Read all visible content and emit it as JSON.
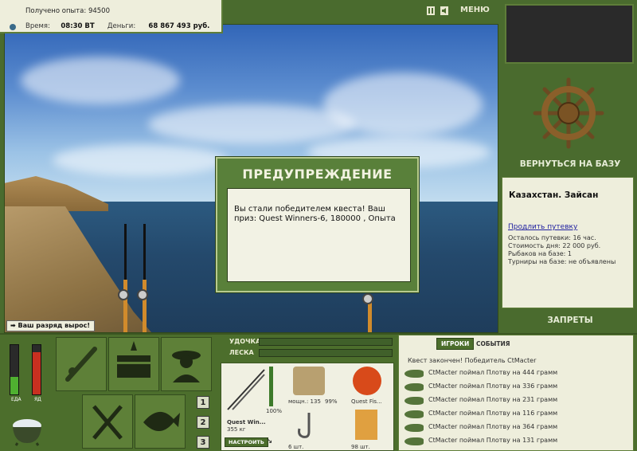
{
  "top_info": {
    "experience": "Получено опыта: 94500",
    "time_label": "Время:",
    "time_value": "08:30 ВТ",
    "money_label": "Деньги:",
    "money_value": "68 867 493 руб."
  },
  "controls": {
    "menu_label": "МЕНЮ"
  },
  "dialog": {
    "title": "ПРЕДУПРЕЖДЕНИЕ",
    "message": "Вы стали победителем квеста! Ваш приз: Quest Winners-6, 180000 , Опыта"
  },
  "rank_badge": "Ваш разряд вырос!",
  "right_panel": {
    "return_label": "ВЕРНУТЬСЯ НА БАЗУ",
    "base_name": "Казахстан. Зайсан",
    "extend_link": "Продлить путевку",
    "lines": [
      "Осталось путевки: 16 час.",
      "Стоимость дня: 22 000 руб.",
      "Рыбаков на базе: 1",
      "Турниры на базе: не объявлены"
    ],
    "bans_label": "ЗАПРЕТЫ"
  },
  "status_bars": {
    "food_label": "ЕДА",
    "poison_label": "ЯД",
    "food_level": 0.35,
    "poison_level": 0.85
  },
  "slots": [
    "1",
    "2",
    "3"
  ],
  "rod_panel": {
    "rod_label": "УДОЧКА",
    "line_label": "ЛЕСКА",
    "rod_name": "Quest Win...",
    "rod_weight": "355 кг",
    "rod_durability": "100%",
    "setup_button": "НАСТРОИТЬ",
    "reel_info": "мощн.: 135",
    "reel_percent": "99%",
    "line_name": "Quest Fis...",
    "hook_count": "6 шт.",
    "bait_count": "98 шт."
  },
  "events_panel": {
    "tab_players": "ИГРОКИ",
    "tab_events": "СОБЫТИЯ",
    "header": "Квест закончен! Победитель CtMacter",
    "events": [
      "CtMacter поймал Плотву на 444 грамм",
      "CtMacter поймал Плотву на 336 грамм",
      "CtMacter поймал Плотву на 231 грамм",
      "CtMacter поймал Плотву на 116 грамм",
      "CtMacter поймал Плотву на 364 грамм",
      "CtMacter поймал Плотву на 131 грамм"
    ]
  }
}
